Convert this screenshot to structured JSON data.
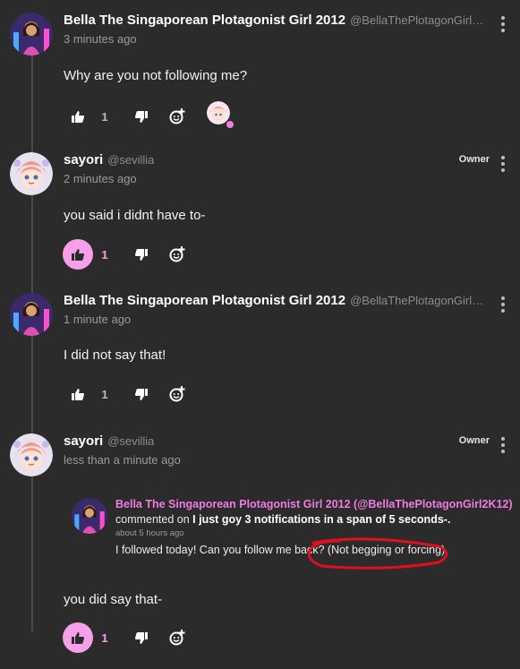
{
  "comments": [
    {
      "author": "Bella The Singaporean Plotagonist Girl 2012",
      "handle": "@BellaThePlotagonGirl2K12",
      "time": "3 minutes ago",
      "text": "Why are you not following me?",
      "likes": "1",
      "liked": false,
      "badge": ""
    },
    {
      "author": "sayori",
      "handle": "@sevillia",
      "time": "2 minutes ago",
      "text": "you said i didnt have to-",
      "likes": "1",
      "liked": true,
      "badge": "Owner"
    },
    {
      "author": "Bella The Singaporean Plotagonist Girl 2012",
      "handle": "@BellaThePlotagonGirl2K12",
      "time": "1 minute ago",
      "text": "I did not say that!",
      "likes": "1",
      "liked": false,
      "badge": ""
    },
    {
      "author": "sayori",
      "handle": "@sevillia",
      "time": "less than a minute ago",
      "text": "you did say that-",
      "likes": "1",
      "liked": true,
      "badge": "Owner",
      "quote": {
        "author": "Bella The Singaporean Plotagonist Girl 2012 (@BellaThePlotagonGirl2K12)",
        "commented_prefix": "commented on",
        "post_title": "I just goy 3 notifications in a span of 5 seconds-.",
        "time": "about 5 hours ago",
        "text": "I followed today! Can you follow me back? (Not begging or forcing)"
      }
    }
  ],
  "colors": {
    "background": "#2b2b2b",
    "accent_pink": "#f5a0e9",
    "annotation_red": "#e0101a"
  },
  "icons": [
    "thumbs-up-icon",
    "thumbs-down-icon",
    "add-reaction-icon",
    "more-vertical-icon"
  ]
}
